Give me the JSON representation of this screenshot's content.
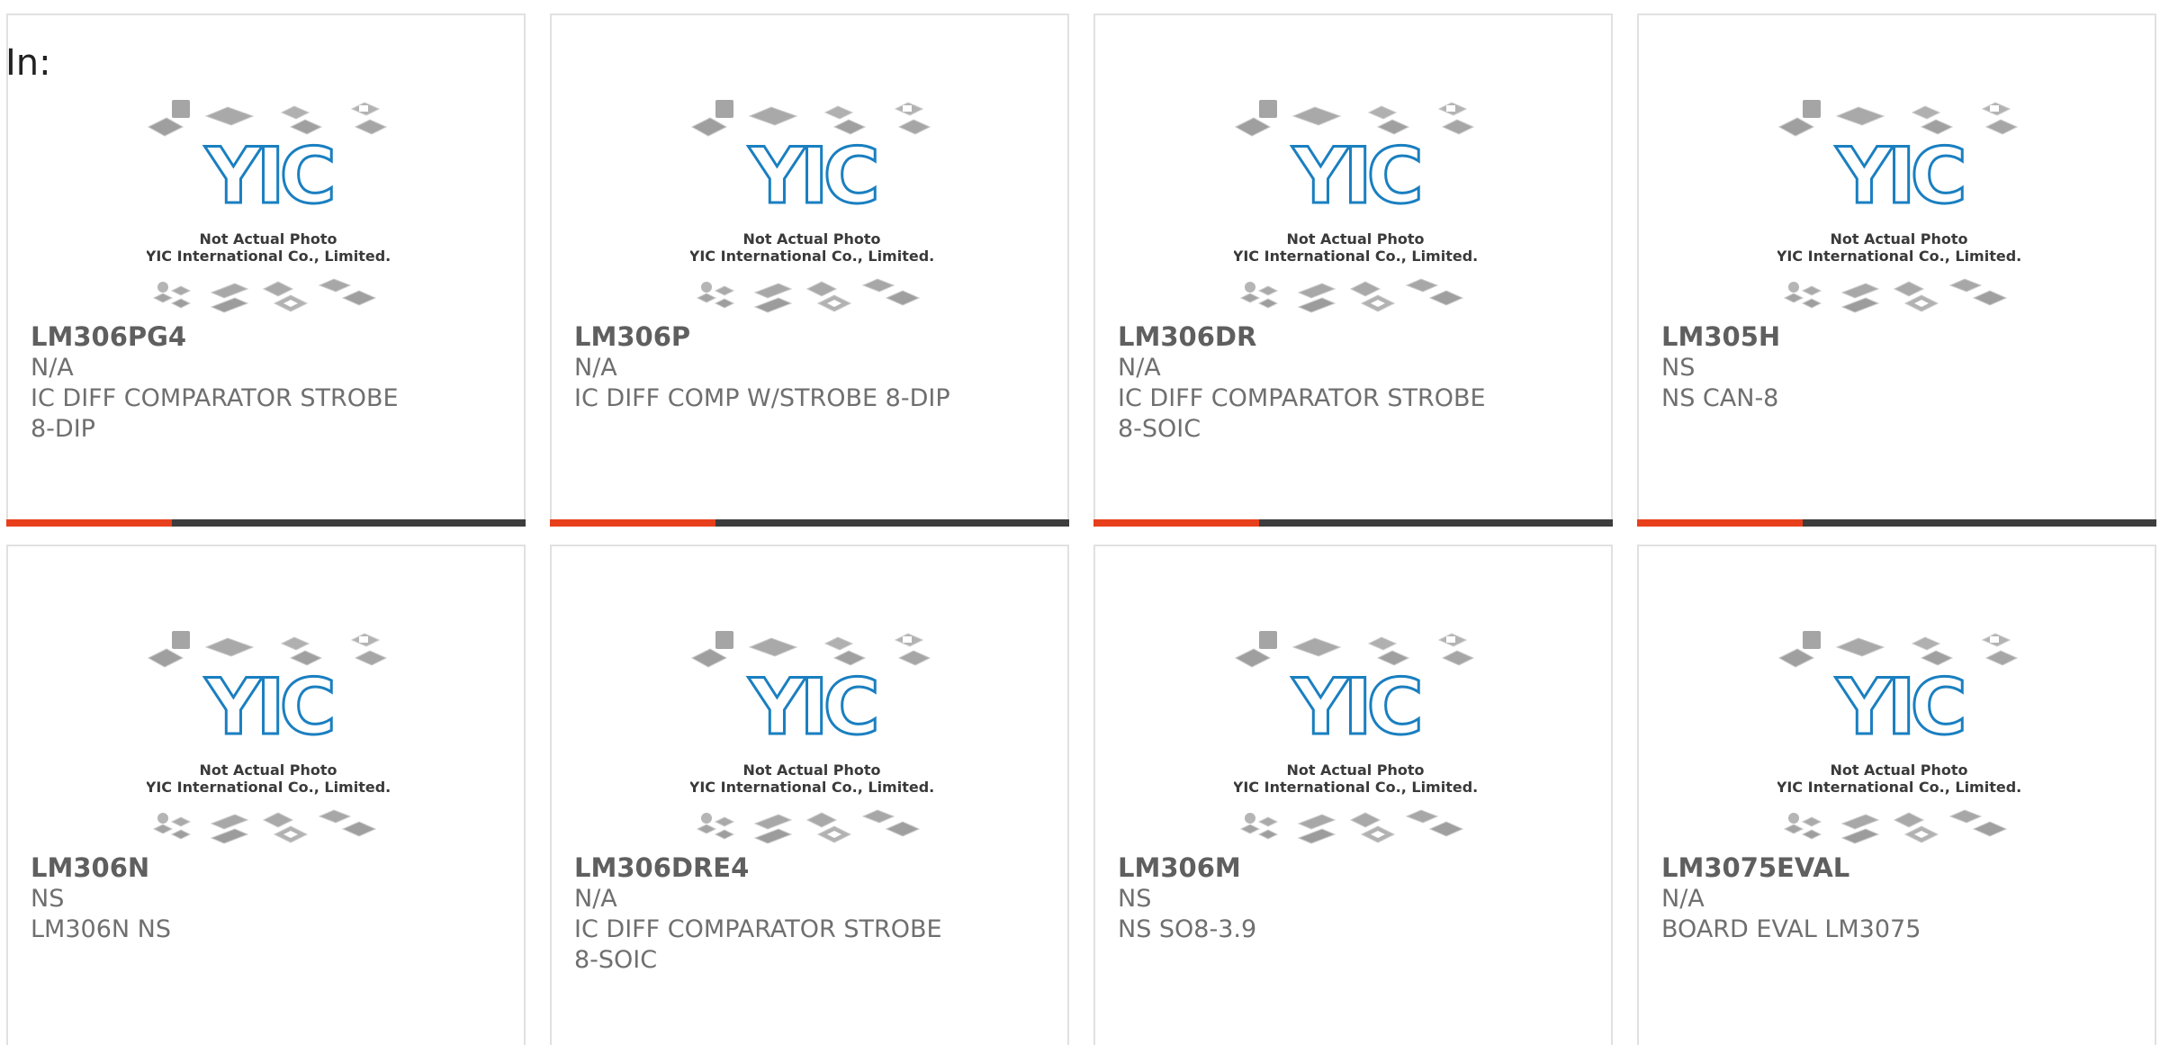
{
  "header": {
    "in_label": "In:"
  },
  "photo": {
    "line1": "Not Actual Photo",
    "line2": "YIC International Co., Limited.",
    "logo_text": "YIC",
    "logo_color": "#1a7fc0"
  },
  "colors": {
    "accent": "#e8401c",
    "bar": "#3d3d3d",
    "text": "#6f6f6f"
  },
  "products": [
    {
      "part": "LM306PG4",
      "brand": "N/A",
      "desc": "IC DIFF COMPARATOR STROBE 8-DIP"
    },
    {
      "part": "LM306P",
      "brand": "N/A",
      "desc": "IC DIFF COMP W/STROBE 8-DIP"
    },
    {
      "part": "LM306DR",
      "brand": "N/A",
      "desc": "IC DIFF COMPARATOR STROBE 8-SOIC"
    },
    {
      "part": "LM305H",
      "brand": "NS",
      "desc": "NS CAN-8"
    },
    {
      "part": "LM306N",
      "brand": "NS",
      "desc": "LM306N NS"
    },
    {
      "part": "LM306DRE4",
      "brand": "N/A",
      "desc": "IC DIFF COMPARATOR STROBE 8-SOIC"
    },
    {
      "part": "LM306M",
      "brand": "NS",
      "desc": "NS SO8-3.9"
    },
    {
      "part": "LM3075EVAL",
      "brand": "N/A",
      "desc": "BOARD EVAL LM3075"
    }
  ]
}
